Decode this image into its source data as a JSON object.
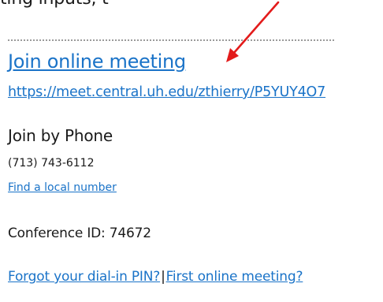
{
  "top_text": "ting inputs, t",
  "join": {
    "link_label": "Join online meeting",
    "url": "https://meet.central.uh.edu/zthierry/P5YUY4O7"
  },
  "phone": {
    "heading": "Join by Phone",
    "number": "(713) 743-6112",
    "local_link": "Find a local number"
  },
  "conference": {
    "id_text": "Conference ID: 74672"
  },
  "footer": {
    "pin_link": "Forgot your dial-in PIN?",
    "separator": "|",
    "first_meeting_link": "First online meeting?"
  },
  "colors": {
    "link": "#1a73c8",
    "text": "#1a1a1a",
    "annotation_arrow": "#e31b1b"
  },
  "icons": {
    "annotation": "red-arrow-icon"
  }
}
